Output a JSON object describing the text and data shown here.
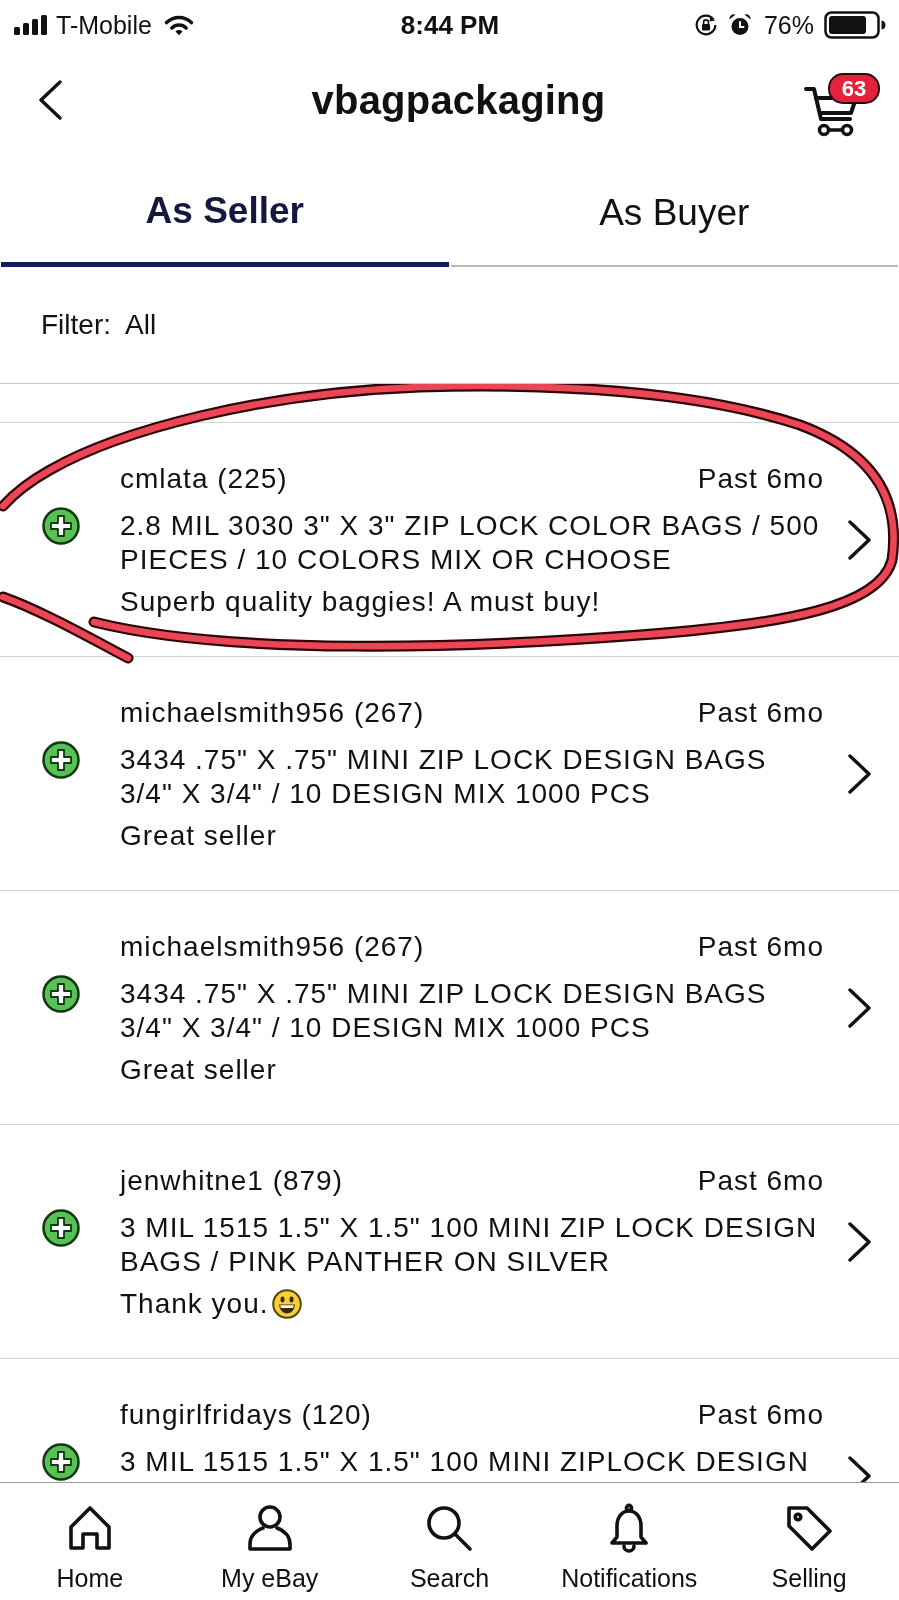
{
  "status_bar": {
    "carrier": "T-Mobile",
    "time": "8:44 PM",
    "battery": "76%"
  },
  "header": {
    "title": "vbagpackaging",
    "cart_count": "63"
  },
  "tabs": [
    {
      "label": "As Seller",
      "selected": true
    },
    {
      "label": "As Buyer",
      "selected": false
    }
  ],
  "filter": {
    "label": "Filter:",
    "value": "All"
  },
  "items": [
    {
      "user": "cmlata (225)",
      "time": "Past 6mo",
      "title": "2.8 MIL 3030 3\" X 3\" ZIP LOCK COLOR BAGS / 500 PIECES / 10 COLORS MIX OR CHOOSE",
      "comment": "Superb quality baggies! A must buy!",
      "emoji": false,
      "circled": true
    },
    {
      "user": "michaelsmith956 (267)",
      "time": "Past 6mo",
      "title": "3434 .75\" X .75\" MINI ZIP LOCK DESIGN BAGS 3/4\" X 3/4\" / 10 DESIGN MIX 1000 PCS",
      "comment": "Great seller",
      "emoji": false,
      "circled": false
    },
    {
      "user": "michaelsmith956 (267)",
      "time": "Past 6mo",
      "title": "3434 .75\" X .75\" MINI ZIP LOCK DESIGN BAGS 3/4\" X 3/4\" / 10 DESIGN MIX 1000 PCS",
      "comment": "Great seller",
      "emoji": false,
      "circled": false
    },
    {
      "user": "jenwhitne1 (879)",
      "time": "Past 6mo",
      "title": "3 MIL 1515 1.5\" X 1.5\" 100 MINI ZIP LOCK DESIGN BAGS / PINK PANTHER ON SILVER",
      "comment": "Thank you.",
      "emoji": true,
      "circled": false
    },
    {
      "user": "fungirlfridays (120)",
      "time": "Past 6mo",
      "title": "3 MIL 1515 1.5\" X 1.5\" 100 MINI ZIPLOCK DESIGN",
      "emoji": false,
      "circled": false
    }
  ],
  "bottom_nav": [
    {
      "label": "Home",
      "kind": "home"
    },
    {
      "label": "My eBay",
      "kind": "account"
    },
    {
      "label": "Search",
      "kind": "search"
    },
    {
      "label": "Notifications",
      "kind": "notifications"
    },
    {
      "label": "Selling",
      "kind": "selling"
    }
  ]
}
